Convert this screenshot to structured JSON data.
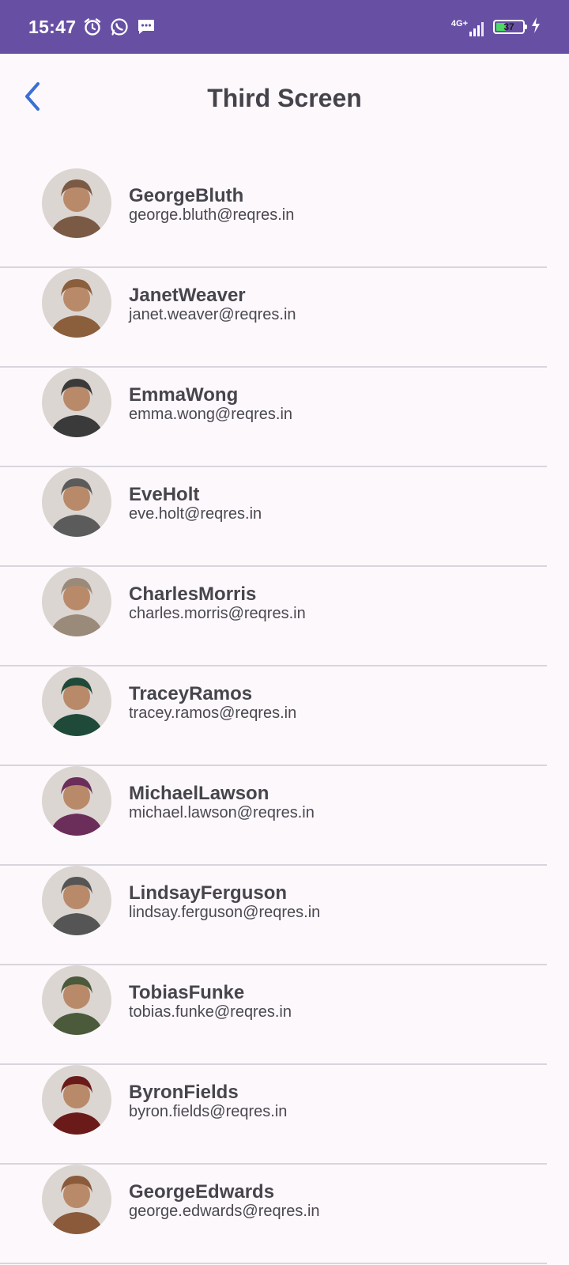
{
  "status": {
    "time": "15:47",
    "network": "4G+",
    "battery": "37",
    "battery_level": 0.37,
    "icons": [
      "alarm-icon",
      "whatsapp-icon",
      "message-icon",
      "signal-icon",
      "battery-icon",
      "charging-icon"
    ]
  },
  "header": {
    "title": "Third Screen",
    "back_icon": "chevron-left-icon"
  },
  "colors": {
    "status_bar": "#6750a4",
    "background": "#fdf8fc",
    "accent": "#3b6fd4",
    "divider": "#d9d5dc"
  },
  "users": [
    {
      "name": "GeorgeBluth",
      "email": "george.bluth@reqres.in",
      "avatar_color": "#7a5a45"
    },
    {
      "name": "JanetWeaver",
      "email": "janet.weaver@reqres.in",
      "avatar_color": "#8b5e3c"
    },
    {
      "name": "EmmaWong",
      "email": "emma.wong@reqres.in",
      "avatar_color": "#3a3a3a"
    },
    {
      "name": "EveHolt",
      "email": "eve.holt@reqres.in",
      "avatar_color": "#5b5b5b"
    },
    {
      "name": "CharlesMorris",
      "email": "charles.morris@reqres.in",
      "avatar_color": "#9a8a7a"
    },
    {
      "name": "TraceyRamos",
      "email": "tracey.ramos@reqres.in",
      "avatar_color": "#1f4a3a"
    },
    {
      "name": "MichaelLawson",
      "email": "michael.lawson@reqres.in",
      "avatar_color": "#6b2e5a"
    },
    {
      "name": "LindsayFerguson",
      "email": "lindsay.ferguson@reqres.in",
      "avatar_color": "#555555"
    },
    {
      "name": "TobiasFunke",
      "email": "tobias.funke@reqres.in",
      "avatar_color": "#4a5a3a"
    },
    {
      "name": "ByronFields",
      "email": "byron.fields@reqres.in",
      "avatar_color": "#6b1a1a"
    },
    {
      "name": "GeorgeEdwards",
      "email": "george.edwards@reqres.in",
      "avatar_color": "#8a5a3a"
    }
  ]
}
